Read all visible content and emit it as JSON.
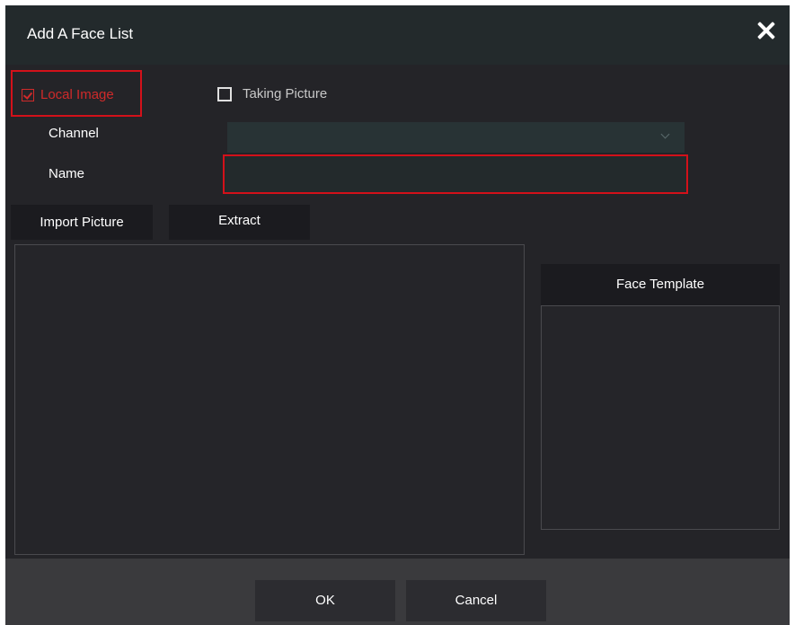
{
  "dialog": {
    "title": "Add A Face List"
  },
  "source": {
    "local_image_label": "Local Image",
    "local_image_checked": true,
    "taking_picture_label": "Taking Picture",
    "taking_picture_checked": false
  },
  "form": {
    "channel_label": "Channel",
    "channel_value": "",
    "name_label": "Name",
    "name_value": ""
  },
  "actions": {
    "import_label": "Import Picture",
    "extract_label": "Extract"
  },
  "template": {
    "header": "Face Template"
  },
  "footer": {
    "ok_label": "OK",
    "cancel_label": "Cancel"
  },
  "colors": {
    "highlight": "#d3111a",
    "accent_text": "#cf2a2a",
    "background": "#242428"
  }
}
